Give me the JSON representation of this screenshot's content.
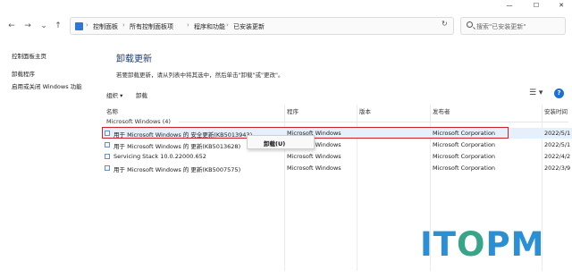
{
  "window": {
    "controls": [
      "—",
      "☐",
      "✕"
    ]
  },
  "nav": {
    "back": "←",
    "forward": "→",
    "recent": "⌄",
    "up": "↑",
    "refresh": "↻"
  },
  "address": {
    "crumbs": [
      "控制面板",
      "所有控制面板项",
      "程序和功能",
      "已安装更新"
    ],
    "separator": "›"
  },
  "search": {
    "placeholder": "搜索\"已安装更新\""
  },
  "leftnav": {
    "items": [
      "控制面板主页",
      "卸载程序",
      "启用或关闭 Windows 功能"
    ]
  },
  "main": {
    "title": "卸载更新",
    "description": "若要卸载更新，请从列表中将其选中，然后单击\"卸载\"或\"更改\"。"
  },
  "toolbar": {
    "organize": "组织 ▾",
    "uninstall": "卸载",
    "view_icon": "☰ ▾",
    "help": "?"
  },
  "columns": [
    "名称",
    "程序",
    "版本",
    "发布者",
    "安装时间"
  ],
  "group": {
    "label": "Microsoft Windows (4)"
  },
  "rows": [
    {
      "name": "用于 Microsoft Windows 的 安全更新(KB5013943)",
      "program": "Microsoft Windows",
      "version": "",
      "publisher": "Microsoft Corporation",
      "installed": "2022/5/1"
    },
    {
      "name": "用于 Microsoft Windows 的 更新(KB5013628)",
      "program": "Microsoft Windows",
      "version": "",
      "publisher": "Microsoft Corporation",
      "installed": "2022/5/1"
    },
    {
      "name": "Servicing Stack 10.0.22000.652",
      "program": "Microsoft Windows",
      "version": "",
      "publisher": "Microsoft Corporation",
      "installed": "2022/4/2"
    },
    {
      "name": "用于 Microsoft Windows 的 更新(KB5007575)",
      "program": "Microsoft Windows",
      "version": "",
      "publisher": "Microsoft Corporation",
      "installed": "2022/3/9"
    }
  ],
  "context_menu": {
    "uninstall": "卸载(U)"
  },
  "watermark": {
    "text": "ITOPM",
    "colors": [
      "#2b8fd6",
      "#36a58a"
    ]
  }
}
